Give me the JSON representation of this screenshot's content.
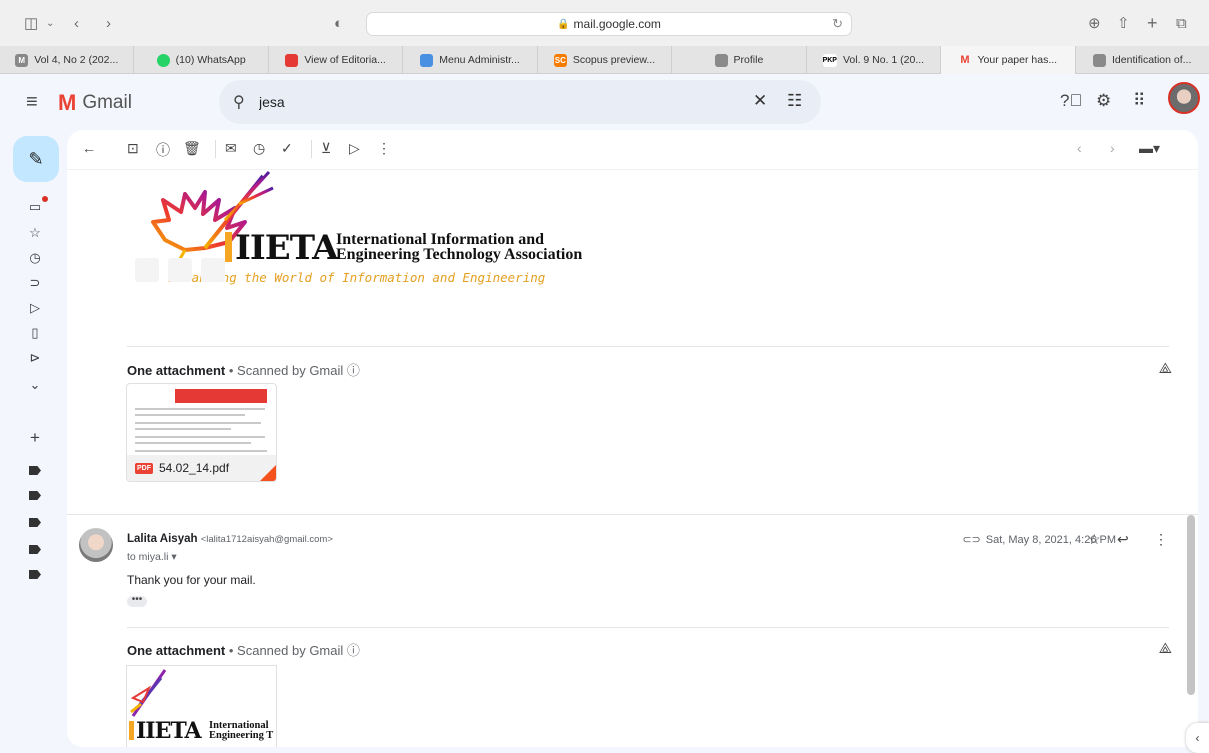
{
  "browser": {
    "url": "mail.google.com",
    "tabs": [
      {
        "label": "Vol 4, No 2 (202...",
        "favicon_color": "#888888",
        "favicon_text": "M"
      },
      {
        "label": "(10) WhatsApp",
        "favicon_color": "#25d366",
        "favicon_text": ""
      },
      {
        "label": "View of Editoria...",
        "favicon_color": "#e53935",
        "favicon_text": ""
      },
      {
        "label": "Menu Administr...",
        "favicon_color": "#4a90e2",
        "favicon_text": ""
      },
      {
        "label": "Scopus preview...",
        "favicon_color": "#f57c00",
        "favicon_text": "SC"
      },
      {
        "label": "Profile",
        "favicon_color": "#8a8a8a",
        "favicon_text": ""
      },
      {
        "label": "Vol. 9 No. 1 (20...",
        "favicon_color": "#ffffff",
        "favicon_text": "PKP"
      },
      {
        "label": "Your paper has...",
        "favicon_color": "#ea4335",
        "favicon_text": "M"
      },
      {
        "label": "Identification of...",
        "favicon_color": "#8a8a8a",
        "favicon_text": ""
      }
    ],
    "active_tab_index": 7
  },
  "gmail": {
    "app_name": "Gmail",
    "search": {
      "value": "jesa"
    }
  },
  "email_body": {
    "brand_acronym": "IIETA",
    "brand_name_line1": "International Information and",
    "brand_name_line2": "Engineering Technology Association",
    "tagline": "Advancing the World of Information and Engineering"
  },
  "attachments_1": {
    "title": "One attachment",
    "subtitle": "Scanned by Gmail",
    "file_name": "54.02_14.pdf",
    "file_type": "PDF"
  },
  "message": {
    "sender_name": "Lalita Aisyah",
    "sender_email": "<lalita1712aisyah@gmail.com>",
    "to": "to miya.li",
    "date": "Sat, May 8, 2021, 4:26 PM",
    "body": "Thank you for your mail.",
    "ellipsis": "•••"
  },
  "attachments_2": {
    "title": "One attachment",
    "subtitle": "Scanned by Gmail",
    "thumb_acronym": "IIETA",
    "thumb_name_line1": "International",
    "thumb_name_line2": "Engineering T"
  },
  "colors": {
    "accent": "#c2e7ff",
    "gmail_red": "#ea4335",
    "iieta_orange": "#f5a623",
    "pdf_red": "#f4511e"
  }
}
